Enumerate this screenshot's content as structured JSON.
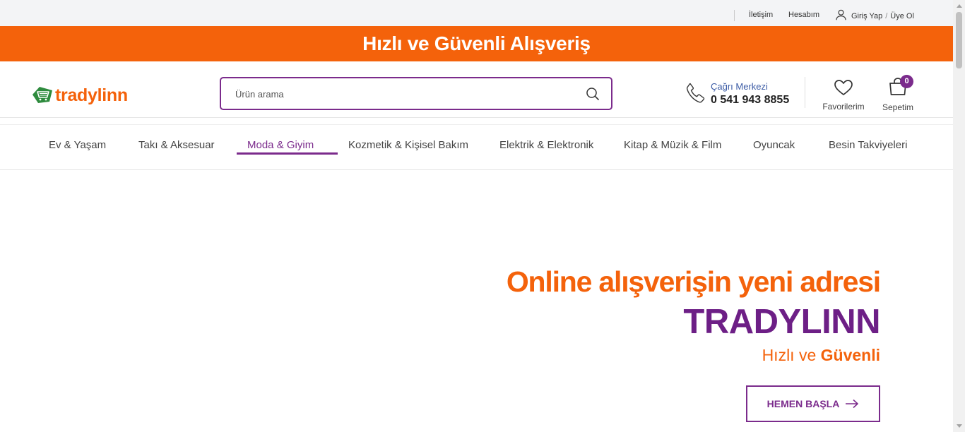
{
  "topbar": {
    "contact_label": "İletişim",
    "account_label": "Hesabım",
    "login_label": "Giriş Yap",
    "login_separator": "/",
    "register_label": "Üye Ol",
    "user_icon": "user-icon"
  },
  "banner": {
    "title": "Hızlı ve Güvenli Alışveriş",
    "color": "#f4620b"
  },
  "header": {
    "logo_text": "tradylinn",
    "logo_icon": "shopping-cart-logo-icon",
    "search": {
      "placeholder": "Ürün arama",
      "value": "",
      "icon": "search-icon"
    },
    "call_center": {
      "label": "Çağrı Merkezi",
      "phone": "0 541 943 8855",
      "icon": "phone-icon"
    },
    "favorites": {
      "label": "Favorilerim",
      "icon": "heart-icon"
    },
    "cart": {
      "label": "Sepetim",
      "count": "0",
      "icon": "shopping-bag-icon"
    }
  },
  "nav": {
    "items": [
      {
        "label": "Ev & Yaşam"
      },
      {
        "label": "Takı & Aksesuar"
      },
      {
        "label": "Moda & Giyim",
        "active": true
      },
      {
        "label": "Kozmetik & Kişisel Bakım"
      },
      {
        "label": "Elektrik & Elektronik"
      },
      {
        "label": "Kitap & Müzik & Film"
      },
      {
        "label": "Oyuncak"
      },
      {
        "label": "Besin Takviyeleri"
      }
    ]
  },
  "hero": {
    "line1": "Online alışverişin yeni adresi",
    "line2": "TRADYLINN",
    "line3_prefix": "Hızlı ve ",
    "line3_bold": "Güvenli",
    "cta_label": "HEMEN BAŞLA",
    "cta_icon": "arrow-right-icon"
  },
  "colors": {
    "brand_orange": "#f4620b",
    "brand_purple": "#7b2b8c",
    "topbar_bg": "#f3f4f6"
  }
}
